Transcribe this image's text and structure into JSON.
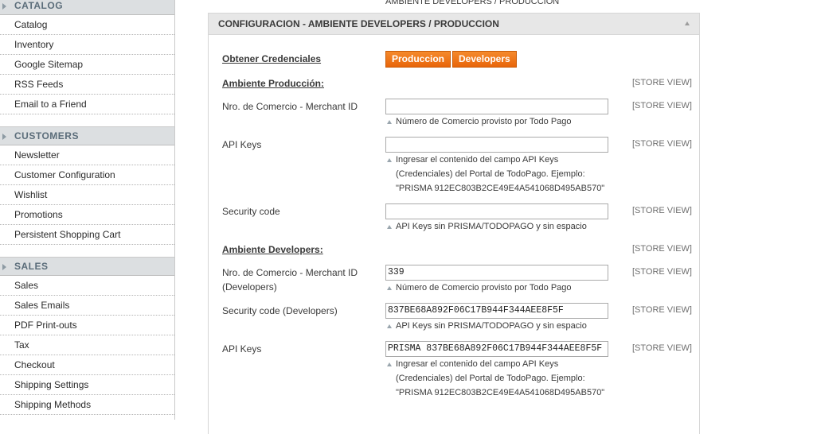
{
  "sidebar": {
    "sections": [
      {
        "title": "CATALOG",
        "items": [
          "Catalog",
          "Inventory",
          "Google Sitemap",
          "RSS Feeds",
          "Email to a Friend"
        ]
      },
      {
        "title": "CUSTOMERS",
        "items": [
          "Newsletter",
          "Customer Configuration",
          "Wishlist",
          "Promotions",
          "Persistent Shopping Cart"
        ]
      },
      {
        "title": "SALES",
        "items": [
          "Sales",
          "Sales Emails",
          "PDF Print-outs",
          "Tax",
          "Checkout",
          "Shipping Settings",
          "Shipping Methods"
        ]
      }
    ]
  },
  "top_title": "AMBIENTE DEVELOPERS / PRODUCCION",
  "section": {
    "title": "CONFIGURACION - AMBIENTE DEVELOPERS / PRODUCCION",
    "credentials_label": "Obtener Credenciales",
    "btn_produccion": "Produccion",
    "btn_developers": "Developers",
    "scope": "[STORE VIEW]",
    "prod_heading": "Ambiente Producción:",
    "prod_merchant_label": "Nro. de Comercio - Merchant ID",
    "prod_merchant_value": "",
    "prod_merchant_note": "Número de Comercio provisto por Todo Pago",
    "prod_apikeys_label": "API Keys",
    "prod_apikeys_value": "",
    "prod_apikeys_note_1": "Ingresar el contenido del campo API Keys",
    "prod_apikeys_note_2": "(Credenciales) del Portal de TodoPago. Ejemplo:",
    "prod_apikeys_note_3": "\"PRISMA 912EC803B2CE49E4A541068D495AB570\"",
    "prod_security_label": "Security code",
    "prod_security_value": "",
    "prod_security_note": "API Keys sin PRISMA/TODOPAGO y sin espacio",
    "dev_heading": "Ambiente Developers:",
    "dev_merchant_label_1": "Nro. de Comercio - Merchant ID",
    "dev_merchant_label_2": "(Developers)",
    "dev_merchant_value": "339",
    "dev_merchant_note": "Número de Comercio provisto por Todo Pago",
    "dev_security_label": "Security code (Developers)",
    "dev_security_value": "837BE68A892F06C17B944F344AEE8F5F",
    "dev_security_note": "API Keys sin PRISMA/TODOPAGO y sin espacio",
    "dev_apikeys_label": "API Keys",
    "dev_apikeys_value": "PRISMA 837BE68A892F06C17B944F344AEE8F5F",
    "dev_apikeys_note_1": "Ingresar el contenido del campo API Keys",
    "dev_apikeys_note_2": "(Credenciales) del Portal de TodoPago. Ejemplo:",
    "dev_apikeys_note_3": "\"PRISMA 912EC803B2CE49E4A541068D495AB570\""
  },
  "colors": {
    "accent_button": "#f07a1f",
    "sidebar_header_bg": "#dcdfe1",
    "sidebar_header_text": "#5b6d7a"
  }
}
